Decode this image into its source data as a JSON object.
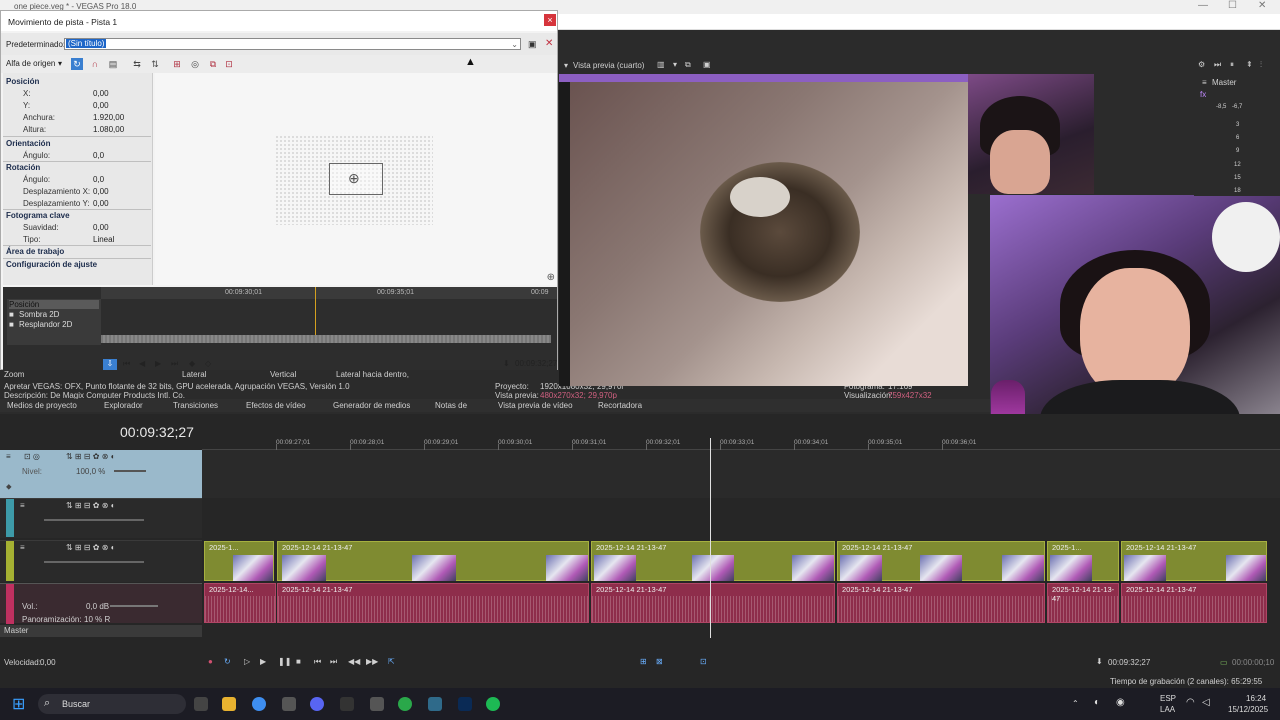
{
  "app": {
    "title": "one piece.veg * - VEGAS Pro 18.0"
  },
  "dialog": {
    "title": "Movimiento de pista - Pista 1",
    "close": "×",
    "preset_label": "Predeterminado:",
    "preset_value": "(Sin título)",
    "source_alpha": "Alfa de origen",
    "groups": {
      "position": "Posición",
      "orientation": "Orientación",
      "rotation": "Rotación",
      "keyframe": "Fotograma clave",
      "workarea": "Área de trabajo",
      "snap": "Configuración de ajuste"
    },
    "props": [
      {
        "name": "X:",
        "value": "0,00"
      },
      {
        "name": "Y:",
        "value": "0,00"
      },
      {
        "name": "Anchura:",
        "value": "1.920,00"
      },
      {
        "name": "Altura:",
        "value": "1.080,00"
      },
      {
        "name": "Ángulo:",
        "value": "0,0"
      },
      {
        "name": "Ángulo:",
        "value": "0,0"
      },
      {
        "name": "Desplazamiento X:",
        "value": "0,00"
      },
      {
        "name": "Desplazamiento Y:",
        "value": "0,00"
      },
      {
        "name": "Suavidad:",
        "value": "0,00"
      },
      {
        "name": "Tipo:",
        "value": "Lineal"
      }
    ],
    "kf_ruler": [
      "00:09:30;01",
      "00:09:35;01",
      "00:09"
    ],
    "kf_tracks": [
      "Posición",
      "Sombra 2D",
      "Resplandor 2D"
    ],
    "kf_time": "00:09:32;27",
    "zoom_row": {
      "zoom": "Zoom",
      "lateral": "Lateral",
      "vertical": "Vertical",
      "inward": "Lateral hacia dentro,",
      "edge": "borde bisero"
    }
  },
  "info": {
    "line1": "Apretar VEGAS: OFX, Punto flotante de 32 bits, GPU acelerada, Agrupación VEGAS, Versión 1.0",
    "line2": "Descripción: De Magix Computer Products Intl. Co.",
    "project_lbl": "Proyecto:",
    "project_val": "1920x1080x32; 29,970i",
    "preview_lbl": "Vista previa:",
    "preview_val": "480x270x32; 29,970p",
    "frame_lbl": "Fotograma:",
    "frame_val": "17.169",
    "display_lbl": "Visualización:",
    "display_val": "759x427x32"
  },
  "window_tabs": [
    "Medios de proyecto",
    "Explorador",
    "Transiciones",
    "Efectos de vídeo",
    "Generador de medios",
    "Notas de",
    "Vista previa de vídeo",
    "Recortadora"
  ],
  "preview": {
    "mode": "Vista previa (cuarto)"
  },
  "mixer": {
    "label": "Master",
    "val_l": "-8,5",
    "val_r": "-6,7",
    "ticks": [
      "3",
      "6",
      "9",
      "12",
      "15",
      "18"
    ]
  },
  "timeline": {
    "timecode": "00:09:32;27",
    "ruler": [
      "00:09:27;01",
      "00:09:28;01",
      "00:09:29;01",
      "00:09:30;01",
      "00:09:31;01",
      "00:09:32;01",
      "00:09:33;01",
      "00:09:34;01",
      "00:09:35;01",
      "00:09:36;01"
    ],
    "level_lbl": "Nivel:",
    "level_val": "100,0 %",
    "vol_lbl": "Vol.:",
    "vol_val": "0,0 dB",
    "pan_lbl": "Panoramización:",
    "pan_val": "10 % R",
    "master": "Master",
    "speed_lbl": "Velocidad:",
    "speed_val": "0,00",
    "video_clips": [
      "2025-1...",
      "2025-12-14 21-13-47",
      "2025-12-14 21-13-47",
      "2025-12-14 21-13-47",
      "2025-1...",
      "2025-12-14 21-13-47"
    ],
    "audio_clips": [
      "2025-12-14...",
      "2025-12-14 21-13-47",
      "2025-12-14 21-13-47",
      "2025-12-14 21-13-47",
      "2025-12-14 21-13-47",
      "2025-12-14 21-13-47"
    ],
    "time_right": "00:09:32;27",
    "time_far": "00:00:00;10",
    "record_time": "Tiempo de grabación (2 canales): 65:29:55"
  },
  "taskbar": {
    "search": "Buscar",
    "lang1": "ESP",
    "lang2": "LAA",
    "time": "16:24",
    "date": "15/12/2025"
  },
  "colors": {
    "accent": "#1e66c8",
    "video_track": "#7f8b31",
    "audio_track": "#8e2d4b",
    "purple": "#8c5fc2"
  }
}
